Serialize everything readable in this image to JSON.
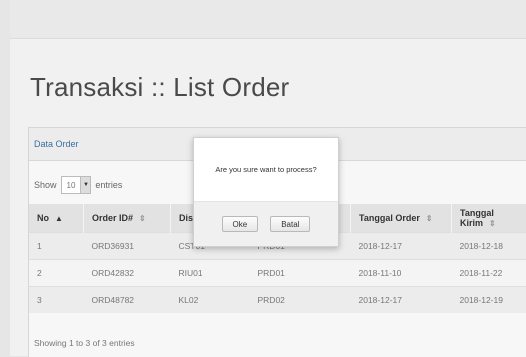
{
  "page": {
    "title": "Transaksi :: List Order",
    "panel_heading": "Data Order"
  },
  "entries": {
    "show_label": "Show",
    "value": "10",
    "suffix": "entries"
  },
  "table": {
    "columns": [
      {
        "label": "No",
        "sort": "▲",
        "active": true
      },
      {
        "label": "Order ID#",
        "sort": "⇕"
      },
      {
        "label": "Distrib",
        "sort": ""
      },
      {
        "label": "",
        "sort": ""
      },
      {
        "label": "Tanggal Order",
        "sort": "⇕"
      },
      {
        "label": "Tanggal Kirim",
        "sort": "⇕"
      }
    ],
    "rows": [
      [
        "1",
        "ORD36931",
        "CST01",
        "PRD01",
        "2018-12-17",
        "2018-12-18"
      ],
      [
        "2",
        "ORD42832",
        "RIU01",
        "PRD01",
        "2018-11-10",
        "2018-11-22"
      ],
      [
        "3",
        "ORD48782",
        "KL02",
        "PRD02",
        "2018-12-17",
        "2018-12-19"
      ]
    ],
    "info": "Showing 1 to 3 of 3 entries"
  },
  "dialog": {
    "message": "Are you sure want to process?",
    "ok_label": "Oke",
    "cancel_label": "Batal"
  }
}
